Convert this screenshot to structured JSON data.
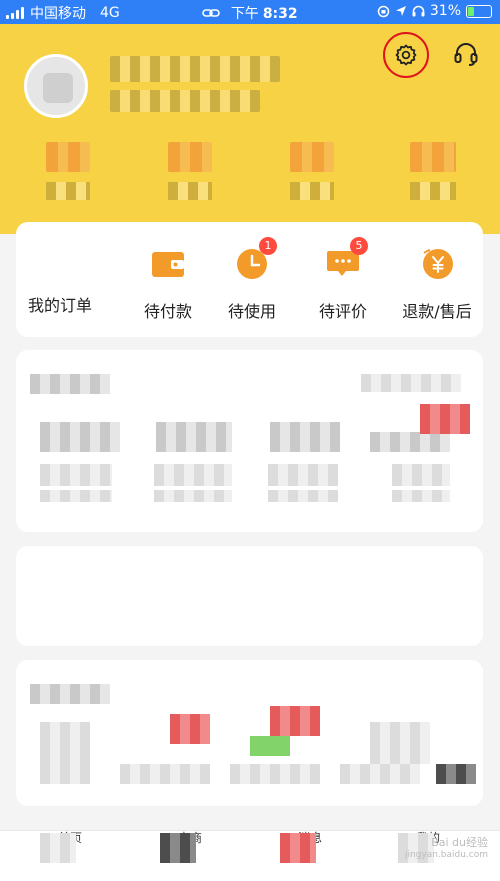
{
  "status_bar": {
    "carrier": "中国移动",
    "network": "4G",
    "time_prefix": "下午",
    "time": "8:32",
    "battery": "31%"
  },
  "header": {
    "settings_icon": "gear-icon",
    "support_icon": "headset-icon",
    "colors": {
      "background": "#f7d245",
      "highlight_ring": "#e0131b"
    }
  },
  "orders": {
    "items": [
      {
        "label": "我的订单",
        "icon": "none",
        "badge": ""
      },
      {
        "label": "待付款",
        "icon": "wallet-icon",
        "badge": ""
      },
      {
        "label": "待使用",
        "icon": "clock-icon",
        "badge": "1"
      },
      {
        "label": "待评价",
        "icon": "comment-icon",
        "badge": "5"
      },
      {
        "label": "退款/售后",
        "icon": "yuan-refund-icon",
        "badge": ""
      }
    ]
  },
  "tabbar": {
    "items": [
      {
        "label": "首页"
      },
      {
        "label": "电商"
      },
      {
        "label": "消息"
      },
      {
        "label": "我的"
      }
    ]
  },
  "watermark": {
    "line1": "Bai du经验",
    "line2": "jingyan.baidu.com"
  }
}
